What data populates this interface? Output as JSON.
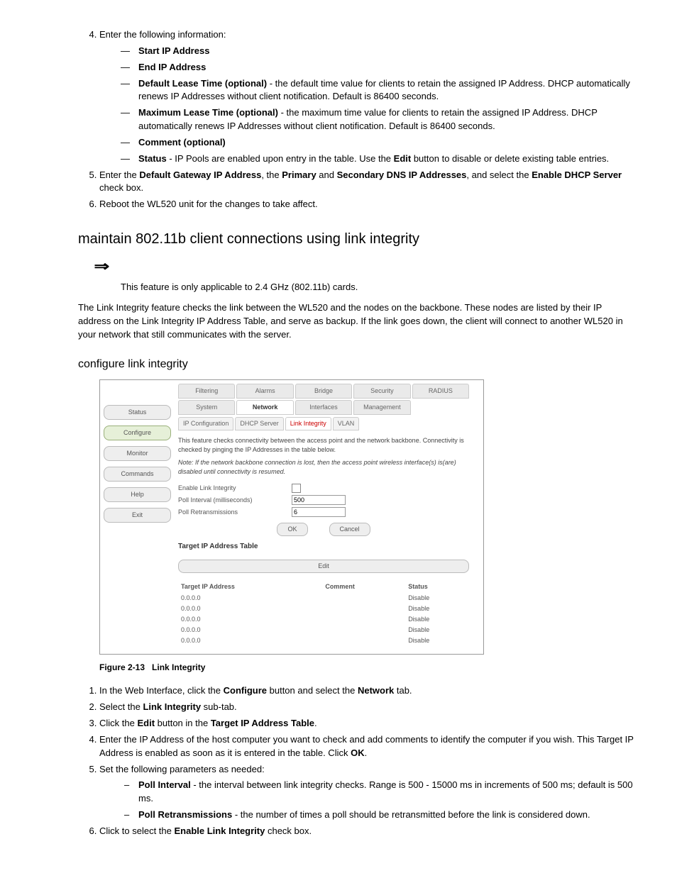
{
  "step4_intro": "Enter the following information:",
  "fields": {
    "start": "Start IP Address",
    "end": "End IP Address",
    "dlt_label": "Default Lease Time (optional)",
    "dlt_text": " - the default time value for clients to retain the assigned IP Address. DHCP automatically renews IP Addresses without client notification. Default is 86400 seconds.",
    "mlt_label": "Maximum Lease Time (optional)",
    "mlt_text": " - the maximum time value for clients to retain the assigned IP Address. DHCP automatically renews IP Addresses without client notification. Default is 86400 seconds.",
    "comment": "Comment (optional)",
    "status_label": "Status",
    "status_text": " - IP Pools are enabled upon entry in the table. Use the ",
    "status_btn": "Edit",
    "status_text2": " button to disable or delete existing table entries."
  },
  "step5_a": "Enter the ",
  "step5_b1": "Default Gateway IP Address",
  "step5_c": ", the ",
  "step5_b2": "Primary",
  "step5_d": " and ",
  "step5_b3": "Secondary DNS IP Addresses",
  "step5_e": ", and select the ",
  "step5_b4": "Enable DHCP Server",
  "step5_f": " check box.",
  "step6": "Reboot the WL520 unit for the changes to take affect.",
  "h2": "maintain 802.11b client connections using link integrity",
  "note": "This feature is only applicable to 2.4 GHz (802.11b) cards.",
  "para": "The Link Integrity feature checks the link between the WL520 and the nodes on the backbone. These nodes are listed by their IP address on the Link Integrity IP Address Table, and serve as backup. If the link goes down, the client will connect to another WL520 in your network that still communicates with the server.",
  "h3": "configure link integrity",
  "fig": {
    "sidebar": [
      "Status",
      "Configure",
      "Monitor",
      "Commands",
      "Help",
      "Exit"
    ],
    "tabs_top": [
      "Filtering",
      "Alarms",
      "Bridge",
      "Security",
      "RADIUS"
    ],
    "tabs_mid": [
      "System",
      "Network",
      "Interfaces",
      "Management"
    ],
    "subtabs": [
      "IP Configuration",
      "DHCP Server",
      "Link Integrity",
      "VLAN"
    ],
    "desc": "This feature checks connectivity between the access point and the network backbone. Connectivity is checked by pinging the IP Addresses in the table below.",
    "note": "Note: If the network backbone connection is lost, then the access point wireless interface(s) is(are) disabled until connectivity is resumed.",
    "row1": "Enable Link Integrity",
    "row2": "Poll Interval (milliseconds)",
    "row2v": "500",
    "row3": "Poll Retransmissions",
    "row3v": "6",
    "ok": "OK",
    "cancel": "Cancel",
    "tbltitle": "Target IP Address Table",
    "edit": "Edit",
    "cols": [
      "Target IP Address",
      "Comment",
      "Status"
    ],
    "rows": [
      [
        "0.0.0.0",
        "",
        "Disable"
      ],
      [
        "0.0.0.0",
        "",
        "Disable"
      ],
      [
        "0.0.0.0",
        "",
        "Disable"
      ],
      [
        "0.0.0.0",
        "",
        "Disable"
      ],
      [
        "0.0.0.0",
        "",
        "Disable"
      ]
    ]
  },
  "figcap_a": "Figure 2-13",
  "figcap_b": "Link Integrity",
  "steps2": {
    "s1a": "In the Web Interface, click the ",
    "s1b": "Configure",
    "s1c": " button and select the ",
    "s1d": "Network",
    "s1e": " tab.",
    "s2a": "Select the ",
    "s2b": "Link Integrity",
    "s2c": " sub-tab.",
    "s3a": "Click the ",
    "s3b": "Edit",
    "s3c": " button in the ",
    "s3d": "Target IP Address Table",
    "s3e": ".",
    "s4a": "Enter the IP Address of the host computer you want to check and add comments to identify the computer if you wish. This Target IP Address is enabled as soon as it is entered in the table. Click ",
    "s4b": "OK",
    "s4c": ".",
    "s5": "Set the following parameters as needed:",
    "p1a": "Poll Interval",
    "p1b": " - the interval between link integrity checks. Range is 500 - 15000 ms in increments of 500 ms; default is 500 ms.",
    "p2a": "Poll Retransmissions",
    "p2b": " - the number of times a poll should be retransmitted before the link is considered down.",
    "s6a": "Click to select the ",
    "s6b": "Enable Link Integrity",
    "s6c": " check box."
  }
}
